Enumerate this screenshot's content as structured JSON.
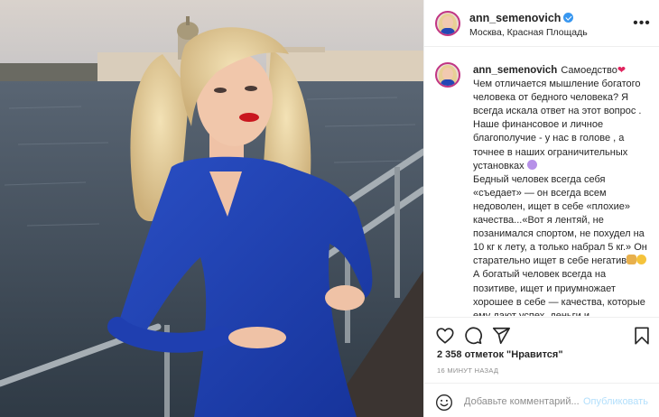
{
  "post": {
    "username": "ann_semenovich",
    "location": "Москва, Красная Площадь",
    "caption_paragraphs": [
      "Самоедство",
      "Чем отличается мышление богатого человека от бедного человека? Я всегда искала ответ на этот вопрос . Наше финансовое и личное благополучие - у нас в голове , а точнее в наших ограничительных установках",
      "Бедный человек всегда себя «съедает» — он всегда всем недоволен, ищет в себе «плохие» качества...«Вот я лентяй, не позанимался спортом, не похудел на 10 кг к лету, а только набрал 5 кг.» Он старательно ищет в себе негатив",
      "А богатый человек всегда на позитиве, ищет и приумножает хорошее в себе — качества, которые ему дают успех, деньги и"
    ],
    "likes": "2 358 отметок \"Нравится\"",
    "time_ago": "16 МИНУТ НАЗАД"
  },
  "comment_box": {
    "placeholder": "Добавьте комментарий...",
    "publish_label": "Опубликовать"
  },
  "colors": {
    "verified": "#3897f0",
    "dress": "#1f3fb0",
    "publish_disabled": "#b2dffc"
  },
  "icons": [
    "more-icon",
    "heart-icon",
    "comment-icon",
    "share-icon",
    "bookmark-icon",
    "smile-icon",
    "verified-icon"
  ]
}
